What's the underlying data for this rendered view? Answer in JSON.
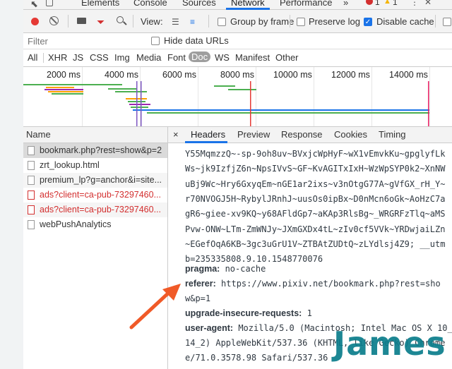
{
  "tabs": [
    "Elements",
    "Console",
    "Sources",
    "Network",
    "Performance"
  ],
  "more_tabs_glyph": "»",
  "error_count": "1",
  "warning_count": "1",
  "toolbar": {
    "view_label": "View:",
    "group_by_frame": "Group by frame",
    "preserve_log": "Preserve log",
    "disable_cache": "Disable cache",
    "preserve_log_checked": false,
    "disable_cache_checked": true,
    "group_by_frame_checked": false
  },
  "filter": {
    "placeholder": "Filter",
    "hide_data_urls": "Hide data URLs"
  },
  "type_filters": [
    "All",
    "XHR",
    "JS",
    "CSS",
    "Img",
    "Media",
    "Font",
    "Doc",
    "WS",
    "Manifest",
    "Other"
  ],
  "selected_type": "Doc",
  "timeline_ticks": [
    "2000 ms",
    "4000 ms",
    "6000 ms",
    "8000 ms",
    "10000 ms",
    "12000 ms",
    "14000 ms"
  ],
  "requests": {
    "header": "Name",
    "items": [
      {
        "name": "bookmark.php?rest=show&p=2",
        "error": false
      },
      {
        "name": "zrt_lookup.html",
        "error": false
      },
      {
        "name": "premium_lp?g=anchor&i=site...",
        "error": false
      },
      {
        "name": "ads?client=ca-pub-73297460...",
        "error": true
      },
      {
        "name": "ads?client=ca-pub-73297460...",
        "error": true
      },
      {
        "name": "webPushAnalytics",
        "error": false
      }
    ]
  },
  "detail_tabs": [
    "×",
    "Headers",
    "Preview",
    "Response",
    "Cookies",
    "Timing"
  ],
  "cookie_lines": [
    "Y55MqmzzQ~-sp-9oh8uv~BVxjcWpHyF~wX1vEmvkKu~gpglyfLk",
    "Ws~jk9IzfjZ6n~NpsIVvS~GF~KvAGITxIxH~WzWpSYP0k2~XnNW",
    "uBj9Wc~Hry6GxyqEm~nGE1ar2ixs~v3nOtgG77A~gVfGX_rH_Y~",
    "r70NVOGJ5H~RybylJRnhJ~uusOs0ipBx~D0nMcn6oGk~AoHzC7a",
    "gR6~giee-xv9KQ~y68AFldGp7~aKAp3RlsBg~_WRGRFzTlq~aMS",
    "Pvw-ONW~LTm-ZmWNJy~JXmGXDx4tL~zIv0cf5VVk~YRDwjaiLZn",
    "~EGefOqA6KB~3gc3uGrU1V~ZTBAtZUDtQ~zLYdlsj4Z9; __utm",
    "b=235335808.9.10.1548770076"
  ],
  "headers": [
    {
      "key": "pragma:",
      "value": "no-cache"
    },
    {
      "key": "referer:",
      "value": "https://www.pixiv.net/bookmark.php?rest=sho",
      "cont": "w&p=1"
    },
    {
      "key": "upgrade-insecure-requests:",
      "value": "1"
    },
    {
      "key": "user-agent:",
      "value": "Mozilla/5.0 (Macintosh; Intel Mac OS X 10_",
      "cont": "14_2) AppleWebKit/537.36 (KHTML, like Gecko) Chrome",
      "cont2": "e/71.0.3578.98 Safari/537.36"
    }
  ],
  "watermark": "James",
  "colors": {
    "accent": "#1a73e8",
    "error": "#d32f2f",
    "arrow": "#f05a28",
    "watermark": "#0a7d8c"
  }
}
